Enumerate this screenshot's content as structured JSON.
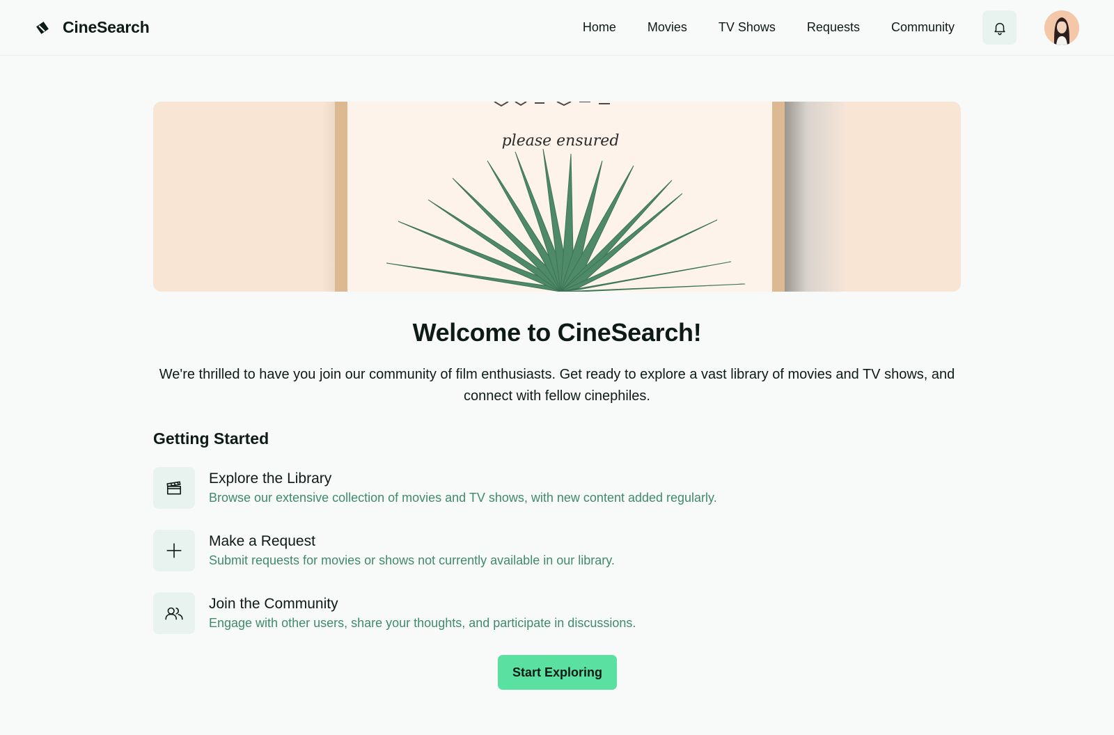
{
  "header": {
    "brand": "CineSearch",
    "logo_icon": "ticket-icon",
    "nav": [
      "Home",
      "Movies",
      "TV Shows",
      "Requests",
      "Community"
    ],
    "notification_icon": "bell-icon",
    "avatar": "user-avatar"
  },
  "hero": {
    "image": "palm-leaf-welcome-card",
    "card_script": "please ensured"
  },
  "welcome": {
    "title": "Welcome to CineSearch!",
    "intro": "We're thrilled to have you join our community of film enthusiasts. Get ready to explore a vast library of movies and TV shows, and connect with fellow cinephiles."
  },
  "getting_started": {
    "title": "Getting Started",
    "steps": [
      {
        "icon": "clapperboard-icon",
        "title": "Explore the Library",
        "desc": "Browse our extensive collection of movies and TV shows, with new content added regularly."
      },
      {
        "icon": "plus-icon",
        "title": "Make a Request",
        "desc": "Submit requests for movies or shows not currently available in our library."
      },
      {
        "icon": "users-icon",
        "title": "Join the Community",
        "desc": "Engage with other users, share your thoughts, and participate in discussions."
      }
    ]
  },
  "cta": {
    "label": "Start Exploring"
  },
  "colors": {
    "accent": "#5ae0a0",
    "description_text": "#3f8a6a",
    "icon_tile": "#e8f2ef",
    "background": "#f8fafa"
  }
}
